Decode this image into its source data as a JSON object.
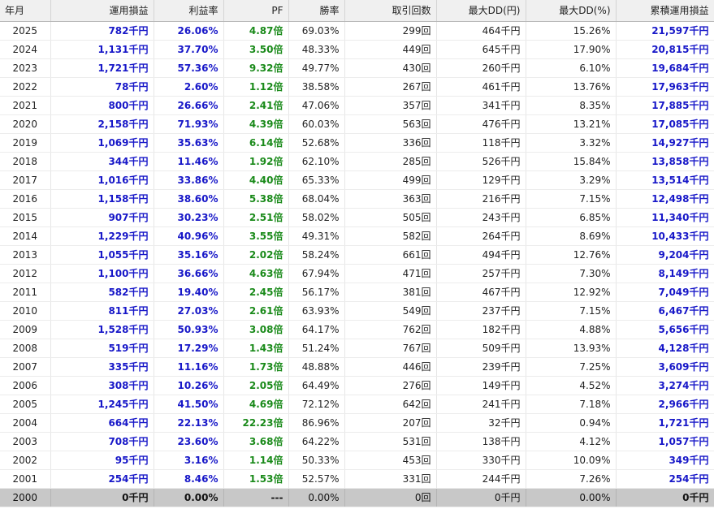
{
  "headers": [
    "年月",
    "運用損益",
    "利益率",
    "PF",
    "勝率",
    "取引回数",
    "最大DD(円)",
    "最大DD(%)",
    "累積運用損益"
  ],
  "rows": [
    [
      "2025",
      "782千円",
      "26.06%",
      "4.87倍",
      "69.03%",
      "299回",
      "464千円",
      "15.26%",
      "21,597千円"
    ],
    [
      "2024",
      "1,131千円",
      "37.70%",
      "3.50倍",
      "48.33%",
      "449回",
      "645千円",
      "17.90%",
      "20,815千円"
    ],
    [
      "2023",
      "1,721千円",
      "57.36%",
      "9.32倍",
      "49.77%",
      "430回",
      "260千円",
      "6.10%",
      "19,684千円"
    ],
    [
      "2022",
      "78千円",
      "2.60%",
      "1.12倍",
      "38.58%",
      "267回",
      "461千円",
      "13.76%",
      "17,963千円"
    ],
    [
      "2021",
      "800千円",
      "26.66%",
      "2.41倍",
      "47.06%",
      "357回",
      "341千円",
      "8.35%",
      "17,885千円"
    ],
    [
      "2020",
      "2,158千円",
      "71.93%",
      "4.39倍",
      "60.03%",
      "563回",
      "476千円",
      "13.21%",
      "17,085千円"
    ],
    [
      "2019",
      "1,069千円",
      "35.63%",
      "6.14倍",
      "52.68%",
      "336回",
      "118千円",
      "3.32%",
      "14,927千円"
    ],
    [
      "2018",
      "344千円",
      "11.46%",
      "1.92倍",
      "62.10%",
      "285回",
      "526千円",
      "15.84%",
      "13,858千円"
    ],
    [
      "2017",
      "1,016千円",
      "33.86%",
      "4.40倍",
      "65.33%",
      "499回",
      "129千円",
      "3.29%",
      "13,514千円"
    ],
    [
      "2016",
      "1,158千円",
      "38.60%",
      "5.38倍",
      "68.04%",
      "363回",
      "216千円",
      "7.15%",
      "12,498千円"
    ],
    [
      "2015",
      "907千円",
      "30.23%",
      "2.51倍",
      "58.02%",
      "505回",
      "243千円",
      "6.85%",
      "11,340千円"
    ],
    [
      "2014",
      "1,229千円",
      "40.96%",
      "3.55倍",
      "49.31%",
      "582回",
      "264千円",
      "8.69%",
      "10,433千円"
    ],
    [
      "2013",
      "1,055千円",
      "35.16%",
      "2.02倍",
      "58.24%",
      "661回",
      "494千円",
      "12.76%",
      "9,204千円"
    ],
    [
      "2012",
      "1,100千円",
      "36.66%",
      "4.63倍",
      "67.94%",
      "471回",
      "257千円",
      "7.30%",
      "8,149千円"
    ],
    [
      "2011",
      "582千円",
      "19.40%",
      "2.45倍",
      "56.17%",
      "381回",
      "467千円",
      "12.92%",
      "7,049千円"
    ],
    [
      "2010",
      "811千円",
      "27.03%",
      "2.61倍",
      "63.93%",
      "549回",
      "237千円",
      "7.15%",
      "6,467千円"
    ],
    [
      "2009",
      "1,528千円",
      "50.93%",
      "3.08倍",
      "64.17%",
      "762回",
      "182千円",
      "4.88%",
      "5,656千円"
    ],
    [
      "2008",
      "519千円",
      "17.29%",
      "1.43倍",
      "51.24%",
      "767回",
      "509千円",
      "13.93%",
      "4,128千円"
    ],
    [
      "2007",
      "335千円",
      "11.16%",
      "1.73倍",
      "48.88%",
      "446回",
      "239千円",
      "7.25%",
      "3,609千円"
    ],
    [
      "2006",
      "308千円",
      "10.26%",
      "2.05倍",
      "64.49%",
      "276回",
      "149千円",
      "4.52%",
      "3,274千円"
    ],
    [
      "2005",
      "1,245千円",
      "41.50%",
      "4.69倍",
      "72.12%",
      "642回",
      "241千円",
      "7.18%",
      "2,966千円"
    ],
    [
      "2004",
      "664千円",
      "22.13%",
      "22.23倍",
      "86.96%",
      "207回",
      "32千円",
      "0.94%",
      "1,721千円"
    ],
    [
      "2003",
      "708千円",
      "23.60%",
      "3.68倍",
      "64.22%",
      "531回",
      "138千円",
      "4.12%",
      "1,057千円"
    ],
    [
      "2002",
      "95千円",
      "3.16%",
      "1.14倍",
      "50.33%",
      "453回",
      "330千円",
      "10.09%",
      "349千円"
    ],
    [
      "2001",
      "254千円",
      "8.46%",
      "1.53倍",
      "52.57%",
      "331回",
      "244千円",
      "7.26%",
      "254千円"
    ]
  ],
  "summary_row": [
    "2000",
    "0千円",
    "0.00%",
    "---",
    "0.00%",
    "0回",
    "0千円",
    "0.00%",
    "0千円"
  ],
  "colors": {
    "profit": "#1717c8",
    "pf": "#1a8a1a",
    "summary_bg": "#c8c8c8",
    "header_bg": "#f0f0f0"
  }
}
